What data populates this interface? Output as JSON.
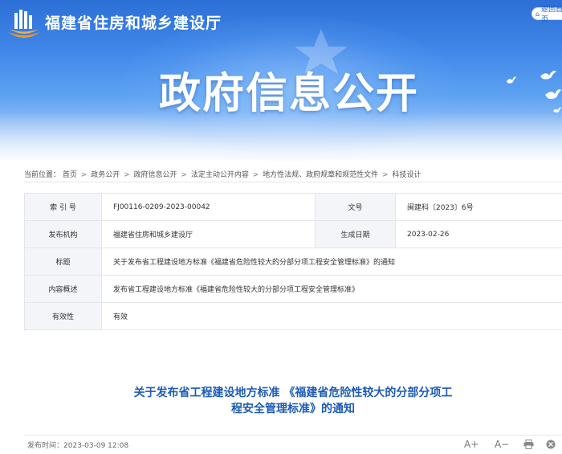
{
  "header": {
    "site_title": "福建省住房和城乡建设厅",
    "back_label": "返回首页",
    "banner_title": "政府信息公开"
  },
  "breadcrumb": {
    "prefix": "当前位置：",
    "items": [
      "首页",
      "政务公开",
      "政府信息公开",
      "法定主动公开内容",
      "地方性法规、政府规章和规范性文件",
      "科技设计"
    ],
    "separator": ">"
  },
  "meta": {
    "index_label": "索 引 号",
    "index_value": "FJ00116-0209-2023-00042",
    "docno_label": "文号",
    "docno_value": "闽建科〔2023〕6号",
    "publisher_label": "发布机构",
    "publisher_value": "福建省住房和城乡建设厅",
    "date_label": "生成日期",
    "date_value": "2023-02-26",
    "title_label": "标题",
    "title_value": "关于发布省工程建设地方标准《福建省危险性较大的分部分项工程安全管理标准》的通知",
    "summary_label": "内容概述",
    "summary_value": "发布省工程建设地方标准《福建省危险性较大的分部分项工程安全管理标准》",
    "validity_label": "有效性",
    "validity_value": "有效"
  },
  "article": {
    "title_line1": "关于发布省工程建设地方标准 《福建省危险性较大的分部分项工",
    "title_line2": "程安全管理标准》的通知",
    "publish_time_label": "发布时间：",
    "publish_time": "2023-03-09 12:08",
    "font_increase": "A+",
    "font_decrease": "A−"
  },
  "icons": {
    "logo": "building-logo-icon",
    "back": "home-icon",
    "print": "print-icon",
    "close": "close-icon"
  },
  "colors": {
    "brand_blue": "#2d6fd6",
    "title_blue": "#1d5bb6",
    "table_key_bg": "#f3f5f8",
    "logo_orange": "#f39a1e"
  }
}
